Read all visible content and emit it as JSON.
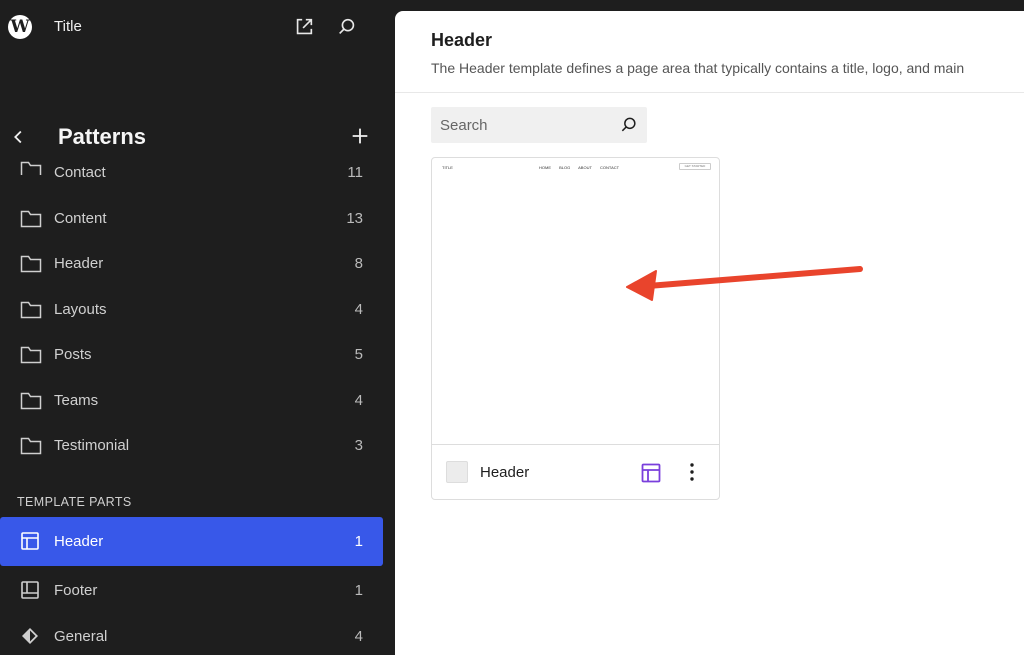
{
  "topbar": {
    "logo_icon": "wordpress-logo-icon",
    "logo_glyph": "W",
    "site_title": "Title",
    "view_site_icon": "external-link-icon",
    "search_icon": "search-icon"
  },
  "sidebar": {
    "title": "Patterns",
    "back_icon": "chevron-left-icon",
    "add_icon": "plus-icon",
    "categories": [
      {
        "label": "Contact",
        "count": "11"
      },
      {
        "label": "Content",
        "count": "13"
      },
      {
        "label": "Header",
        "count": "8"
      },
      {
        "label": "Layouts",
        "count": "4"
      },
      {
        "label": "Posts",
        "count": "5"
      },
      {
        "label": "Teams",
        "count": "4"
      },
      {
        "label": "Testimonial",
        "count": "3"
      }
    ],
    "section_title": "TEMPLATE PARTS",
    "template_parts": [
      {
        "label": "Header",
        "count": "1",
        "icon": "header-layout-icon",
        "active": true
      },
      {
        "label": "Footer",
        "count": "1",
        "icon": "footer-layout-icon",
        "active": false
      },
      {
        "label": "General",
        "count": "4",
        "icon": "diamond-icon",
        "active": false
      }
    ]
  },
  "main": {
    "title": "Header",
    "description": "The Header template defines a page area that typically contains a title, logo, and main",
    "search": {
      "placeholder": "Search",
      "value": ""
    },
    "card": {
      "label": "Header",
      "type_icon": "header-layout-icon",
      "more_icon": "more-vertical-icon",
      "preview": {
        "title": "TITLE",
        "nav": [
          "HOME",
          "BLOG",
          "ABOUT",
          "CONTACT"
        ],
        "button": "GET STARTED"
      }
    }
  },
  "colors": {
    "sidebar_bg": "#1e1e1e",
    "accent": "#3858e9",
    "type_icon": "#7a3fdc",
    "annotation_arrow": "#e9442c"
  }
}
